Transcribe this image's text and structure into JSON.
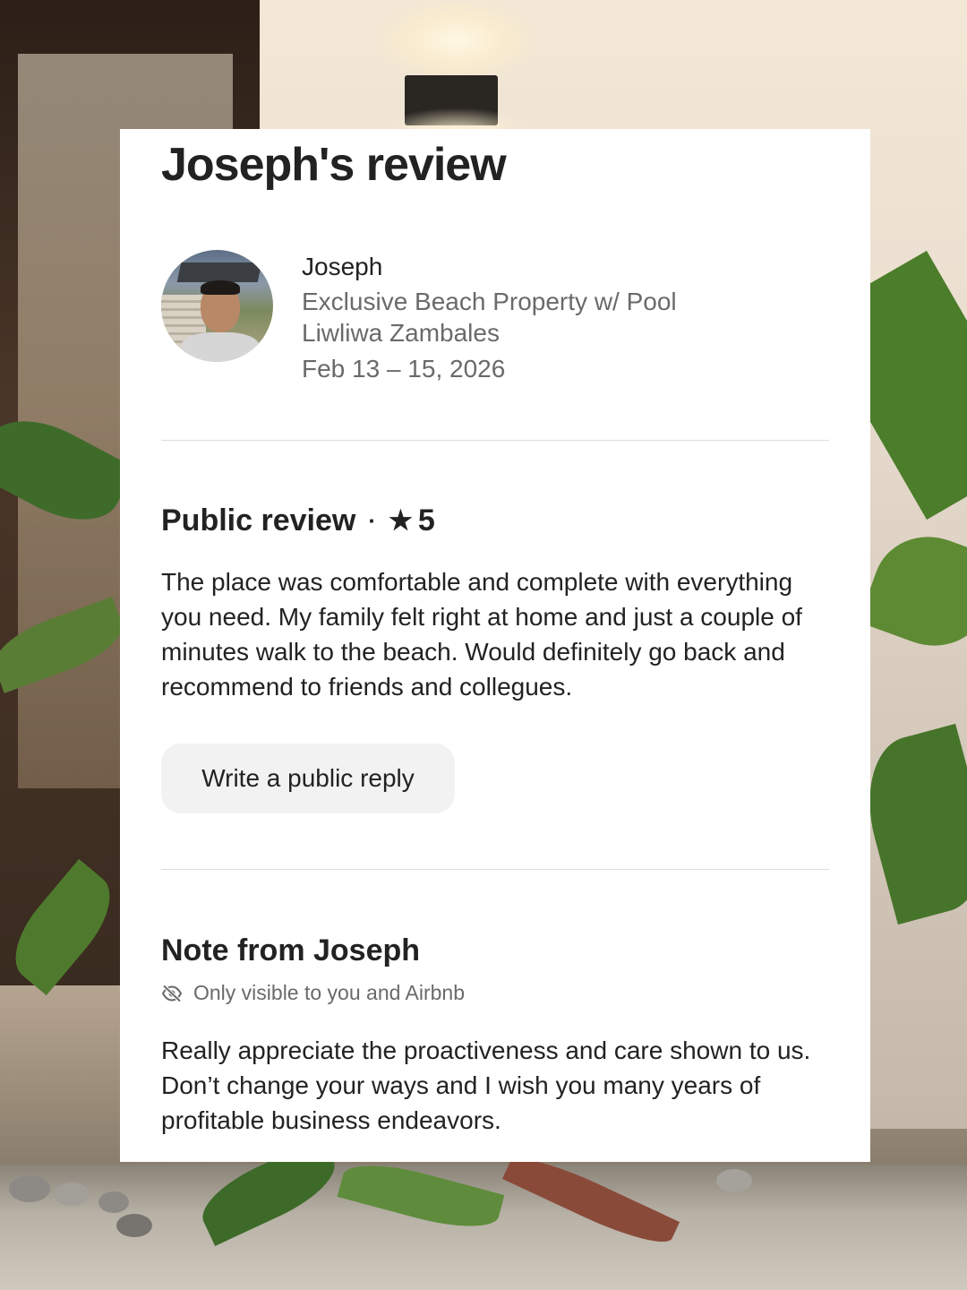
{
  "page": {
    "title": "Joseph's review"
  },
  "reviewer": {
    "name": "Joseph",
    "listing_title": "Exclusive Beach Property w/ Pool",
    "listing_location": "Liwliwa Zambales",
    "stay_dates": "Feb 13 – 15, 2026",
    "avatar_icon": "profile-photo"
  },
  "public_review": {
    "heading": "Public review",
    "separator": "·",
    "star_icon": "★",
    "rating": "5",
    "text": "The place was comfortable and complete with everything you need. My family felt right at home and just a couple of minutes walk to the beach. Would definitely go back and recommend to friends and collegues.",
    "reply_button_label": "Write a public reply"
  },
  "private_note": {
    "heading": "Note from Joseph",
    "visibility_icon": "eye-slash-icon",
    "visibility_text": "Only visible to you and Airbnb",
    "text": "Really appreciate the proactiveness and care shown to us. Don’t change your ways and I wish you many years of profitable business endeavors."
  },
  "colors": {
    "primary_text": "#222222",
    "secondary_text": "#6a6a6a",
    "divider": "#dddddd",
    "button_bg": "#f2f2f2",
    "card_bg": "#ffffff"
  }
}
